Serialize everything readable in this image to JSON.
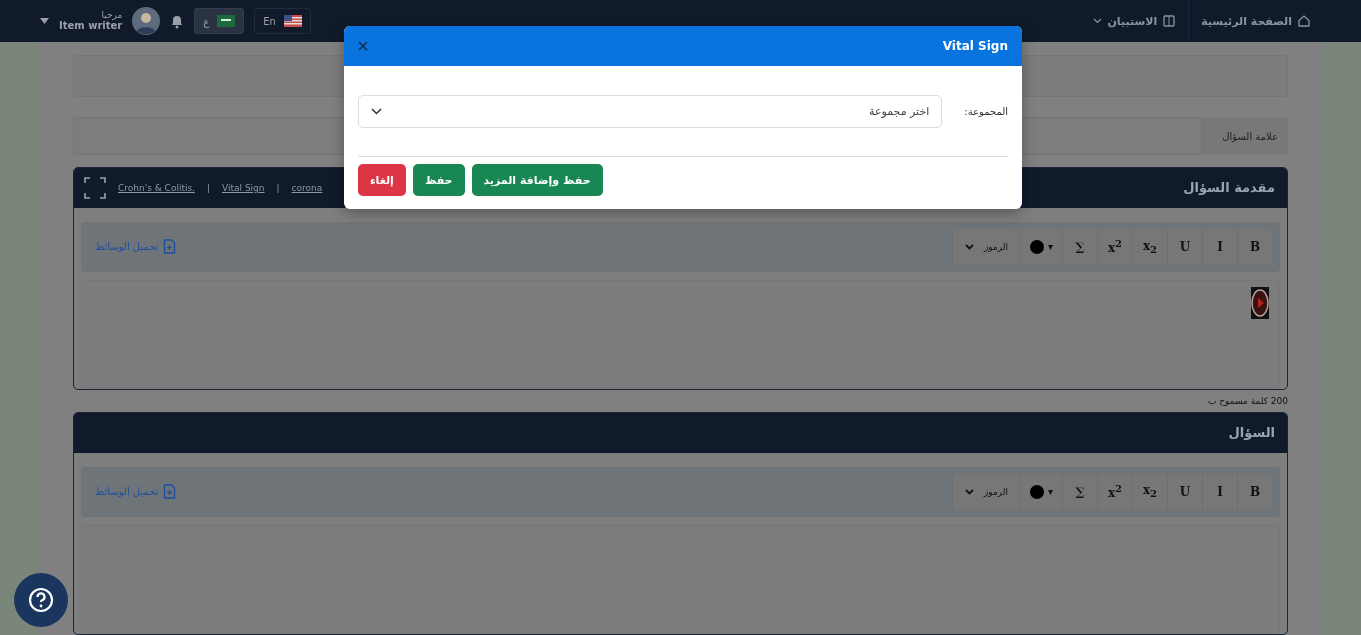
{
  "navbar": {
    "home": "الصفحة الرئيسية",
    "survey": "الاستبيان",
    "greeting": "مرحبا",
    "user": "Item writer",
    "languages": [
      {
        "label": "En",
        "selected": false
      },
      {
        "label": "ع",
        "selected": true
      }
    ]
  },
  "form": {
    "mark_label": "علامة السؤال"
  },
  "editors": [
    {
      "title": "مقدمة السؤال",
      "tags": [
        "corona",
        "Vital Sign",
        "Crohn's & Colitis."
      ],
      "tag_separator": "|",
      "upload": "تحميل الوسائط",
      "has_video": true,
      "counter": "200 كلمة مسموح ب",
      "toolbar": [
        {
          "kind": "text",
          "label": "B"
        },
        {
          "kind": "text",
          "label": "I"
        },
        {
          "kind": "text",
          "label": "U"
        },
        {
          "kind": "text",
          "label": "x$_{2}$"
        },
        {
          "kind": "text",
          "label": "x$^{2}$"
        },
        {
          "kind": "text",
          "label": "∑"
        },
        {
          "kind": "color",
          "label": "▾"
        },
        {
          "kind": "dropdown",
          "label": "الرموز"
        }
      ]
    },
    {
      "title": "السؤال",
      "upload": "تحميل الوسائط",
      "has_video": false,
      "toolbar": [
        {
          "kind": "text",
          "label": "B"
        },
        {
          "kind": "text",
          "label": "I"
        },
        {
          "kind": "text",
          "label": "U"
        },
        {
          "kind": "text",
          "label": "x$_{2}$"
        },
        {
          "kind": "text",
          "label": "x$^{2}$"
        },
        {
          "kind": "text",
          "label": "∑"
        },
        {
          "kind": "color",
          "label": "▾"
        },
        {
          "kind": "dropdown",
          "label": "الرموز"
        }
      ]
    }
  ],
  "dialog": {
    "title": "Vital Sign",
    "field_label": "المجموعة:",
    "placeholder": "اختر مجموعة",
    "buttons": [
      {
        "label": "حفظ وإضافة المزيد",
        "kind": "primary"
      },
      {
        "label": "حفظ",
        "kind": "primary"
      },
      {
        "label": "إلغاء",
        "kind": "danger"
      }
    ]
  }
}
